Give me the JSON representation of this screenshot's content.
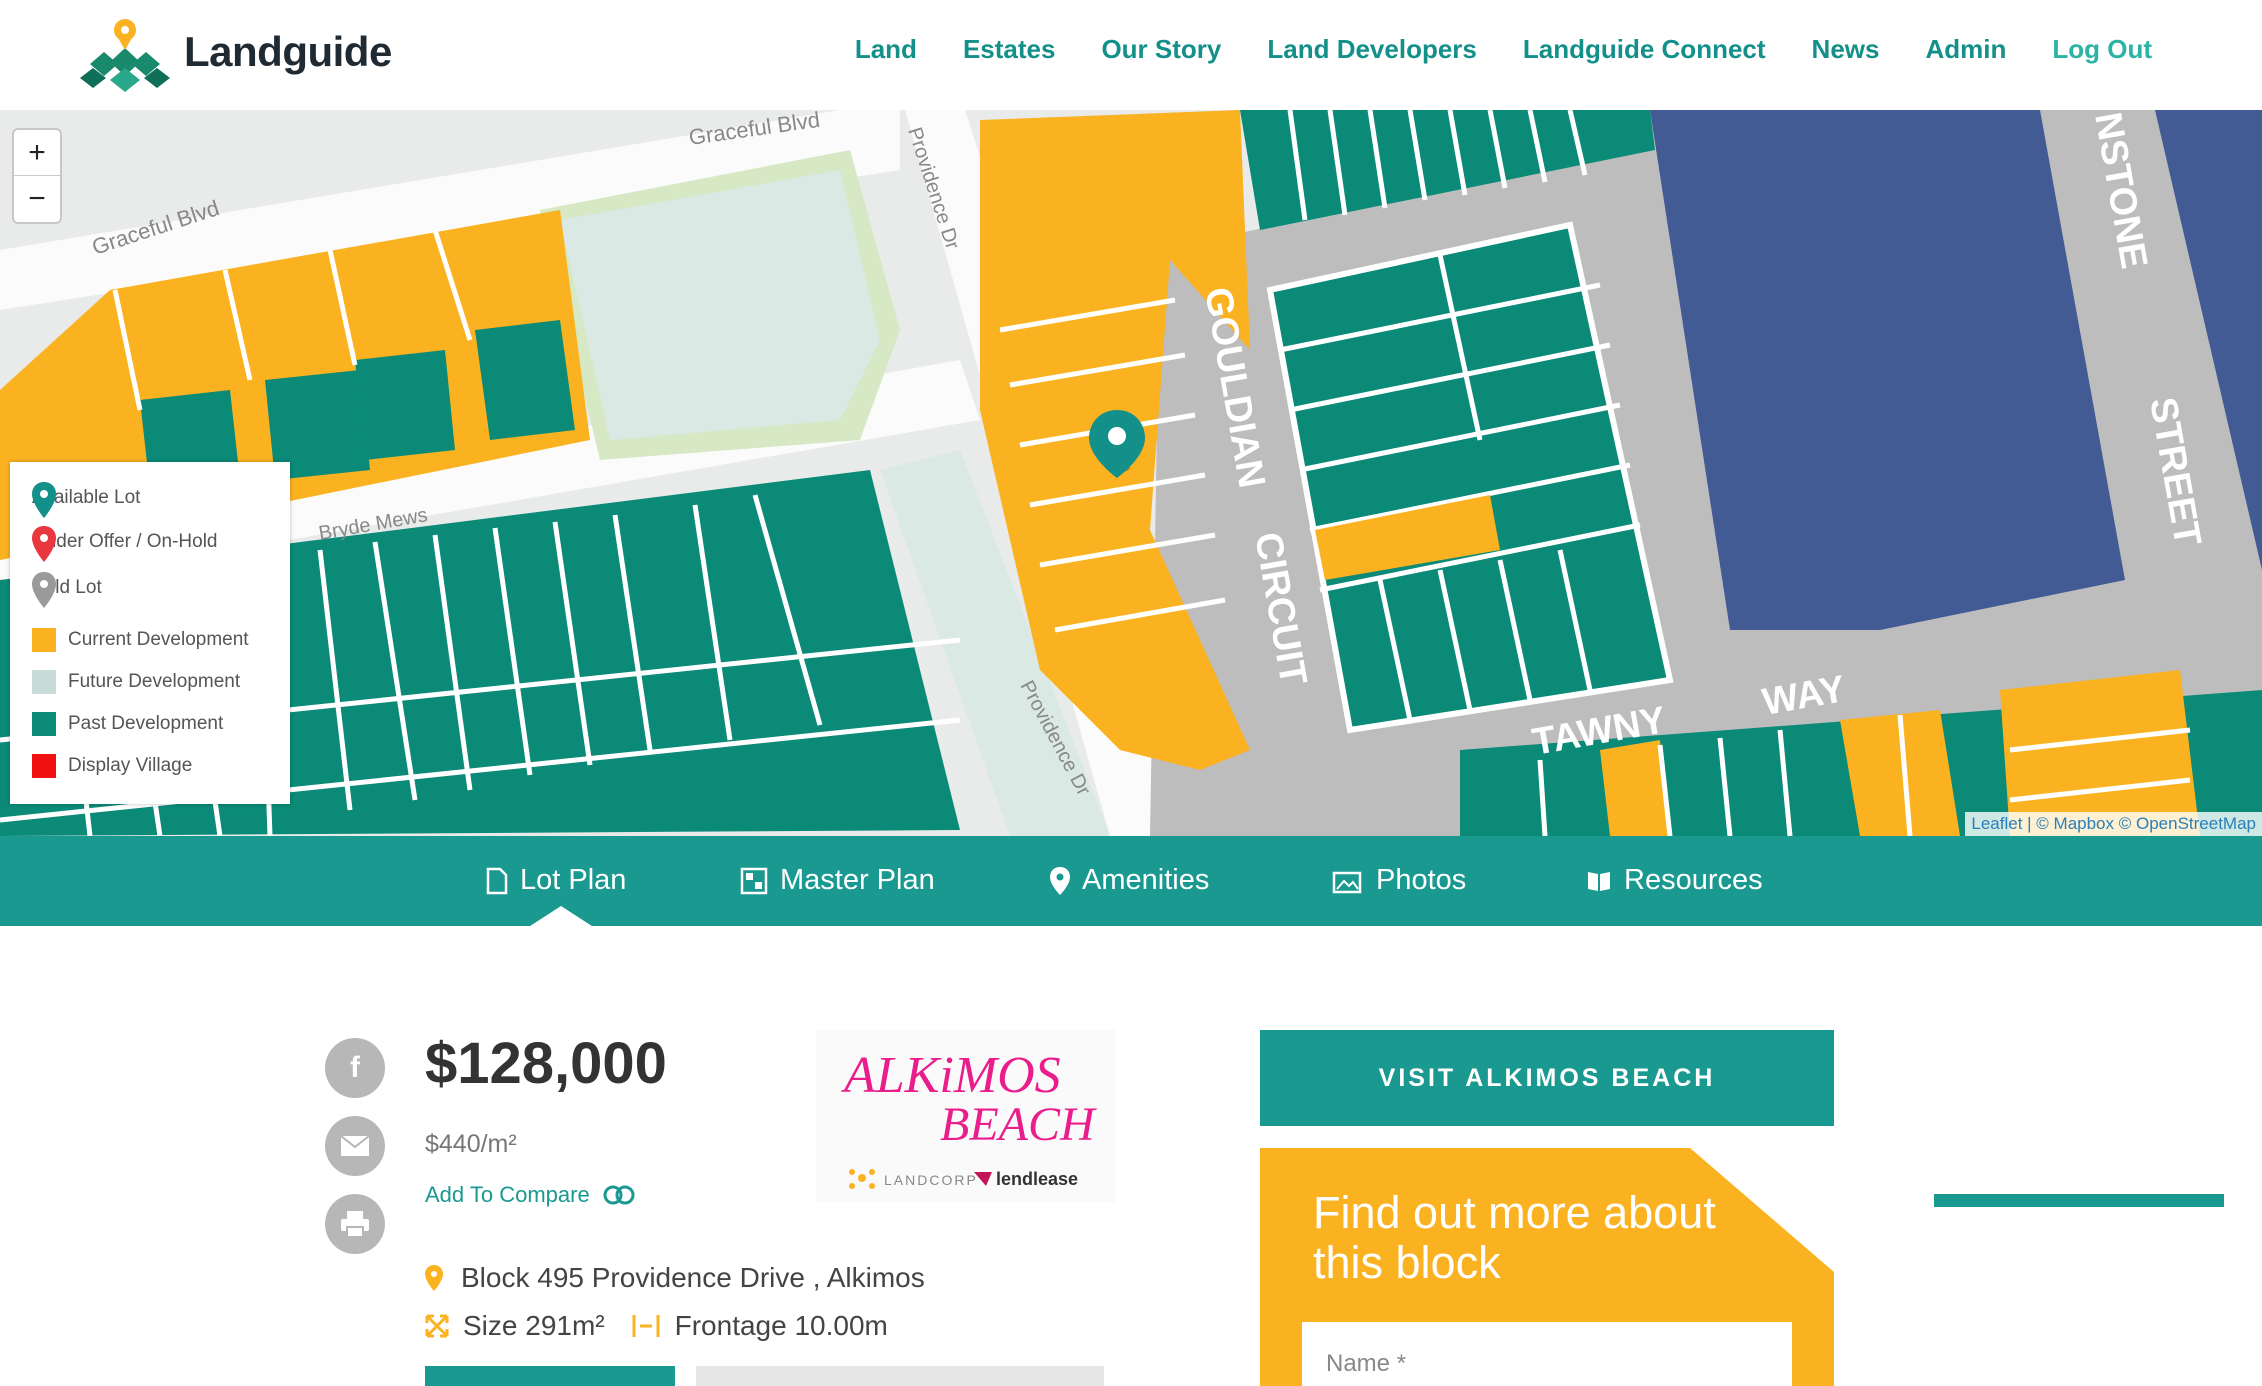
{
  "header": {
    "logo_text": "Landguide",
    "nav": [
      {
        "label": "Land"
      },
      {
        "label": "Estates"
      },
      {
        "label": "Our Story"
      },
      {
        "label": "Land Developers"
      },
      {
        "label": "Landguide Connect"
      },
      {
        "label": "News"
      },
      {
        "label": "Admin"
      },
      {
        "label": "Log Out"
      }
    ]
  },
  "map": {
    "zoom_in": "+",
    "zoom_out": "−",
    "street_labels": {
      "graceful_blvd_1": "Graceful Blvd",
      "graceful_blvd_2": "Graceful Blvd",
      "providence_dr_1": "Providence Dr",
      "providence_dr_2": "Providence Dr",
      "bryde_mews": "Bryde Mews",
      "gouldian": "GOULDIAN",
      "circuit": "CIRCUIT",
      "tawny": "TAWNY",
      "way": "WAY",
      "nstone": "NSTONE",
      "street": "STREET"
    },
    "legend": [
      {
        "label": "Available Lot",
        "color": "#13908a",
        "kind": "pin"
      },
      {
        "label": "Under Offer / On-Hold",
        "color": "#e8373f",
        "kind": "pin"
      },
      {
        "label": "Sold Lot",
        "color": "#9a9a9a",
        "kind": "pin"
      },
      {
        "label": "Current Development",
        "color": "#fbb221",
        "kind": "square"
      },
      {
        "label": "Future Development",
        "color": "#c7dcd8",
        "kind": "square"
      },
      {
        "label": "Past Development",
        "color": "#0b8a78",
        "kind": "square"
      },
      {
        "label": "Display Village",
        "color": "#f01010",
        "kind": "square"
      }
    ],
    "attribution": "Leaflet | © Mapbox © OpenStreetMap"
  },
  "tabs": [
    {
      "label": "Lot Plan",
      "icon": "file-icon"
    },
    {
      "label": "Master Plan",
      "icon": "plan-icon"
    },
    {
      "label": "Amenities",
      "icon": "map-pin-icon"
    },
    {
      "label": "Photos",
      "icon": "photos-icon"
    },
    {
      "label": "Resources",
      "icon": "book-icon"
    }
  ],
  "lot": {
    "price": "$128,000",
    "price_per_m2": "$440/m²",
    "add_to_compare": "Add To Compare",
    "address": "Block 495 Providence Drive , Alkimos",
    "size": "Size 291m²",
    "frontage": "Frontage 10.00m"
  },
  "estate_logo": {
    "line1": "ALKiMOS",
    "line2": "BEACH",
    "partner1": "LANDCORP",
    "partner2": "lendlease"
  },
  "sidebar": {
    "visit_button": "VISIT ALKIMOS BEACH",
    "enquiry_title": "Find out more about this block",
    "name_placeholder": "Name *"
  },
  "colors": {
    "teal": "#1a9990",
    "orange": "#fbb221",
    "navy": "#425b94",
    "past": "#0b8a78"
  }
}
